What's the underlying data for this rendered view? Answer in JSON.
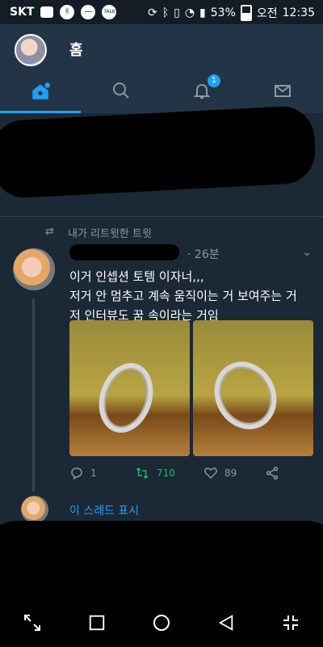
{
  "status_bar": {
    "carrier": "SKT",
    "battery": "53%",
    "ampm": "오전",
    "time": "12:35",
    "icons": [
      "chat-icon",
      "v-icon",
      "minus-icon",
      "talk-icon",
      "sync-icon",
      "bluetooth-icon",
      "vibrate-icon",
      "wifi-icon",
      "signal-icon",
      "battery-icon"
    ],
    "talk_text": "TALK"
  },
  "header": {
    "title": "홈",
    "tabs": [
      {
        "name": "home",
        "icon": "home-icon",
        "active": true
      },
      {
        "name": "search",
        "icon": "search-icon",
        "active": false
      },
      {
        "name": "notifications",
        "icon": "bell-icon",
        "active": false,
        "badge": "1"
      },
      {
        "name": "messages",
        "icon": "mail-icon",
        "active": false
      }
    ],
    "accent": "#1da1f2"
  },
  "tweet": {
    "retweet_label": "내가 리트윗한 트윗",
    "time": "26분",
    "lines": [
      "이거 인셉션 토템 이자너,,,",
      "저거 안 멈추고 계속 움직이는 거 보여주는 거",
      "저 인터뷰도 꿈 속이라는 거임"
    ],
    "replies": "1",
    "retweets": "710",
    "likes": "89"
  },
  "show_thread": "이 스레드 표시",
  "colors": {
    "background": "#1b2836",
    "header": "#243447",
    "retweet_green": "#17bf63"
  }
}
